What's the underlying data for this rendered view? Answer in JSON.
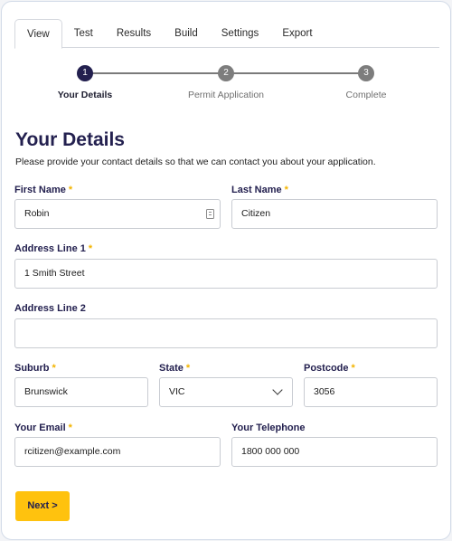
{
  "tabs": [
    "View",
    "Test",
    "Results",
    "Build",
    "Settings",
    "Export"
  ],
  "steps": [
    {
      "number": "1",
      "label": "Your Details"
    },
    {
      "number": "2",
      "label": "Permit Application"
    },
    {
      "number": "3",
      "label": "Complete"
    }
  ],
  "form": {
    "title": "Your Details",
    "intro": "Please provide your contact details so that we can contact you about your application.",
    "required_marker": "*",
    "first_name": {
      "label": "First Name",
      "value": "Robin"
    },
    "last_name": {
      "label": "Last Name",
      "value": "Citizen"
    },
    "address1": {
      "label": "Address Line 1",
      "value": "1 Smith Street"
    },
    "address2": {
      "label": "Address Line 2",
      "value": ""
    },
    "suburb": {
      "label": "Suburb",
      "value": "Brunswick"
    },
    "state": {
      "label": "State",
      "value": "VIC"
    },
    "postcode": {
      "label": "Postcode",
      "value": "3056"
    },
    "email": {
      "label": "Your Email",
      "value": "rcitizen@example.com"
    },
    "telephone": {
      "label": "Your Telephone",
      "value": "1800 000 000"
    },
    "next_label": "Next >"
  },
  "colors": {
    "heading": "#23204f",
    "required": "#f3b400",
    "button": "#ffc20e",
    "active_step": "#23204f",
    "inactive_step": "#7d7d7d"
  }
}
